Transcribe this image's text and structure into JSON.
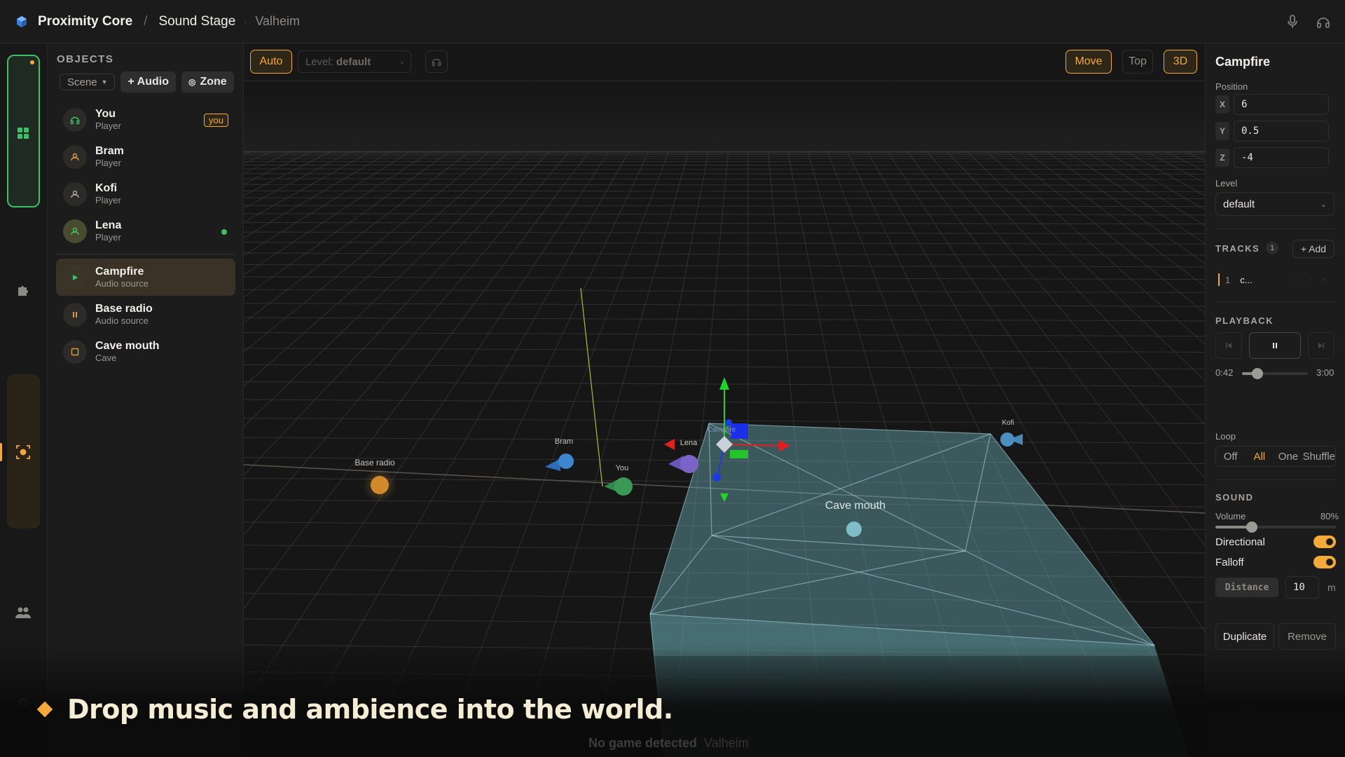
{
  "app": {
    "name": "Proximity Core",
    "section": "Sound Stage",
    "game": "Valheim"
  },
  "colors": {
    "accent": "#f4a93b",
    "success": "#3fbf6a",
    "zone": "#6fb8c0"
  },
  "objects": {
    "title": "OBJECTS",
    "scene_label": "Scene",
    "add_audio": "+ Audio",
    "add_zone": "Zone",
    "players": [
      {
        "name": "You",
        "type": "Player",
        "badge": "you",
        "icon": "headphones-icon"
      },
      {
        "name": "Bram",
        "type": "Player",
        "icon": "user-icon"
      },
      {
        "name": "Kofi",
        "type": "Player",
        "icon": "user-icon"
      },
      {
        "name": "Lena",
        "type": "Player",
        "icon": "user-icon",
        "online": true
      }
    ],
    "sources": [
      {
        "name": "Campfire",
        "type": "Audio source",
        "icon": "play-icon",
        "selected": true
      },
      {
        "name": "Base radio",
        "type": "Audio source",
        "icon": "pause-icon"
      },
      {
        "name": "Cave mouth",
        "type": "Cave",
        "icon": "square-icon"
      }
    ]
  },
  "viewport": {
    "auto_label": "Auto",
    "level_prefix": "Level:",
    "level_value": "default",
    "move_label": "Move",
    "top_label": "Top",
    "view3d_label": "3D",
    "labels": {
      "base_radio": "Base radio",
      "bram": "Bram",
      "you": "You",
      "lena": "Lena",
      "kofi": "Kofi",
      "campfire": "Campfire",
      "cave_mouth": "Cave mouth"
    }
  },
  "props": {
    "title": "Campfire",
    "position_label": "Position",
    "x": "6",
    "y": "0.5",
    "z": "-4",
    "level_label": "Level",
    "level_value": "default",
    "tracks_label": "TRACKS",
    "tracks_count": "1",
    "add_track": "+ Add",
    "track": {
      "index": "1",
      "name": "c..."
    },
    "playback_label": "PLAYBACK",
    "time_current": "0:42",
    "time_total": "3:00",
    "progress_fraction": 0.233,
    "loop_label": "Loop",
    "loop_options": [
      "Off",
      "All",
      "One",
      "Shuffle"
    ],
    "loop_selected": "All",
    "sound_label": "SOUND",
    "volume_label": "Volume",
    "volume_value": "80%",
    "volume_fraction": 0.3,
    "directional_label": "Directional",
    "falloff_label": "Falloff",
    "distance_label": "Distance",
    "distance_value": "10",
    "distance_unit": "m",
    "duplicate": "Duplicate",
    "remove": "Remove"
  },
  "status": {
    "text": "No game detected",
    "game": "Valheim"
  },
  "caption": "Drop music and ambience into the world."
}
